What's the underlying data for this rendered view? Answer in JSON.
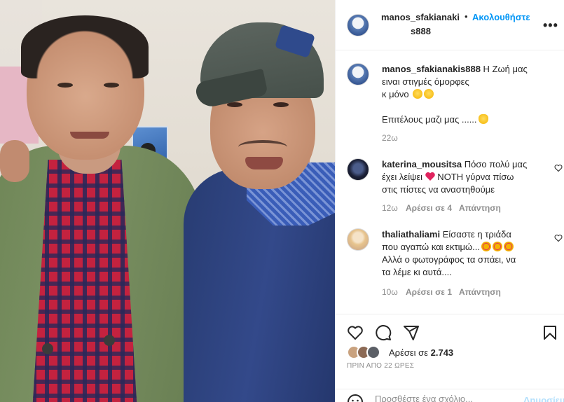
{
  "header": {
    "username_line1": "manos_sfakianaki",
    "username_line2": "s888",
    "separator": "•",
    "follow_label": "Ακολουθήστε",
    "more_label": "•••"
  },
  "caption": {
    "username": "manos_sfakianakis888",
    "text_line1": " Η Ζωή μας",
    "text_line2": "ειναι στιγμές όμορφες",
    "text_line3": "κ μόνο",
    "text_line4": "Επιτέλους μαζι μας ......",
    "time": "22ω"
  },
  "comments": [
    {
      "username": "katerina_mousitsa",
      "text_a": " Πόσο πολύ μας",
      "text_b": "έχει λείψει",
      "text_c": " NOTH γύρνα πίσω",
      "text_d": "στις πίστες να αναστηθούμε",
      "time": "12ω",
      "likes": "Αρέσει σε 4",
      "reply": "Απάντηση"
    },
    {
      "username": "thaliathaliami",
      "text_a": " Είσαστε η τριάδα",
      "text_b": "που αγαπώ και εκτιμώ...",
      "text_c": "Αλλά ο φωτογράφος τα σπάει, να",
      "text_d": "τα λέμε κι αυτά....",
      "time": "10ω",
      "likes": "Αρέσει σε 1",
      "reply": "Απάντηση"
    }
  ],
  "actions": {
    "likes_prefix": "Αρέσει σε ",
    "likes_count": "2.743",
    "time_ago": "ΠΡΙΝ ΑΠΟ 22 ΩΡΕΣ"
  },
  "add_comment": {
    "placeholder": "Προσθέστε ένα σχόλιο...",
    "post_label": "Δημοσίευση"
  },
  "colors": {
    "accent": "#0095f6",
    "text": "#262626",
    "muted": "#8e8e8e",
    "heart": "#ed4956"
  },
  "icons": [
    "more-icon",
    "heart-icon",
    "comment-icon",
    "share-icon",
    "bookmark-icon",
    "emoji-icon"
  ]
}
